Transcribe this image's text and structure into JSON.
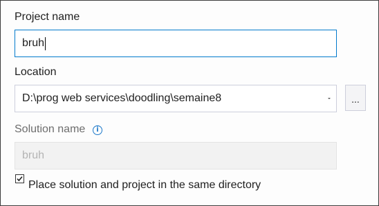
{
  "project": {
    "label": "Project name",
    "value": "bruh"
  },
  "location": {
    "label": "Location",
    "value": "D:\\prog web services\\doodling\\semaine8",
    "browse_label": "..."
  },
  "solution": {
    "label": "Solution name",
    "info_icon": "i",
    "value": "bruh"
  },
  "same_directory": {
    "label": "Place solution and project in the same directory",
    "checked": true
  },
  "colors": {
    "focus_border": "#007acc",
    "info_icon": "#1a77c9"
  }
}
